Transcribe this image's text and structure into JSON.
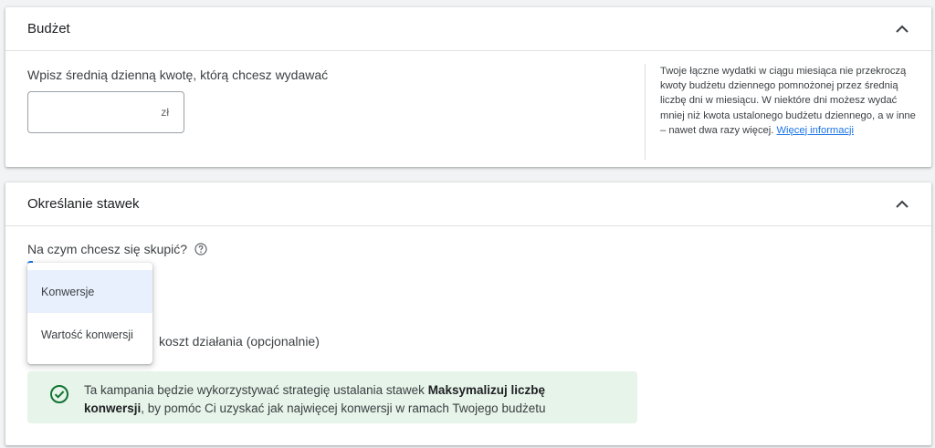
{
  "budget": {
    "title": "Budżet",
    "input_label": "Wpisz średnią dzienną kwotę, którą chcesz wydawać",
    "input_value": "",
    "currency": "zł",
    "help_text": "Twoje łączne wydatki w ciągu miesiąca nie przekroczą kwoty budżetu dziennego pomnożonej przez średnią liczbę dni w miesiącu. W niektóre dni możesz wydać mniej niż kwota ustalonego budżetu dziennego, a w inne – nawet dwa razy więcej.",
    "help_link": "Więcej informacji"
  },
  "bidding": {
    "title": "Określanie stawek",
    "focus_label": "Na czym chcesz się skupić?",
    "cost_label": "koszt działania (opcjonalnie)",
    "info_text_before": "Ta kampania będzie wykorzystywać strategię ustalania stawek ",
    "info_text_bold_1": "Maksymalizuj liczbę",
    "info_text_bold_2": "konwersji",
    "info_text_after": ", by pomóc Ci uzyskać jak najwięcej konwersji w ramach Twojego budżetu"
  },
  "dropdown": {
    "options": [
      "Konwersje",
      "Wartość konwersji"
    ],
    "selected": "Konwersje"
  },
  "icons": {
    "collapse": "chevron-up-icon",
    "help": "help-circle-icon",
    "success": "check-circle-icon"
  },
  "colors": {
    "accent": "#1a73e8",
    "success_bg": "#e6f4ea",
    "success_icon": "#137333",
    "selected_bg": "#e8f0fe"
  }
}
